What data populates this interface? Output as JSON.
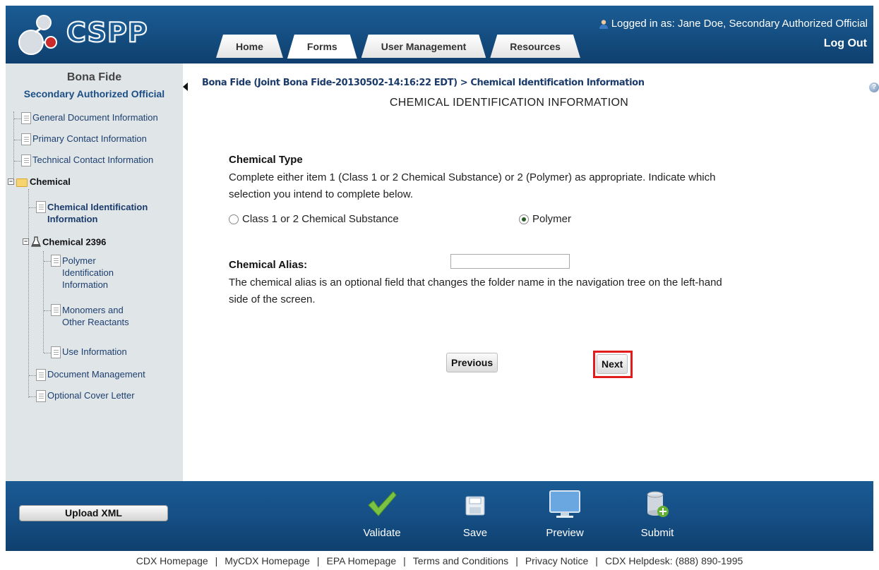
{
  "header": {
    "app_name": "CSPP",
    "logged_in_text": "Logged in as: Jane Doe, Secondary Authorized Official",
    "logout_label": "Log Out",
    "tabs": [
      {
        "label": "Home",
        "active": false
      },
      {
        "label": "Forms",
        "active": true
      },
      {
        "label": "User Management",
        "active": false
      },
      {
        "label": "Resources",
        "active": false
      }
    ]
  },
  "sidebar": {
    "title": "Bona Fide",
    "subtitle": "Secondary Authorized Official",
    "items": [
      {
        "label": "General Document Information"
      },
      {
        "label": "Primary Contact Information"
      },
      {
        "label": "Technical Contact Information"
      },
      {
        "label": "Chemical"
      },
      {
        "label_line1": "Chemical Identification",
        "label_line2": "Information"
      },
      {
        "label": "Chemical 2396"
      },
      {
        "label_line1": "Polymer",
        "label_line2": "Identification",
        "label_line3": "Information"
      },
      {
        "label_line1": "Monomers and",
        "label_line2": "Other Reactants"
      },
      {
        "label": "Use Information"
      },
      {
        "label": "Document Management"
      },
      {
        "label": "Optional Cover Letter"
      }
    ]
  },
  "main": {
    "breadcrumb": "Bona Fide (Joint Bona Fide-20130502-14:16:22 EDT) > Chemical Identification Information",
    "page_title": "CHEMICAL IDENTIFICATION INFORMATION",
    "chemical_type": {
      "heading": "Chemical Type",
      "instructions_line1": "Complete either item 1 (Class 1 or 2 Chemical Substance) or 2 (Polymer) as appropriate. Indicate which",
      "instructions_line2": "selection you intend to complete below.",
      "options": [
        {
          "label": "Class 1 or 2 Chemical Substance",
          "selected": false
        },
        {
          "label": "Polymer",
          "selected": true
        }
      ]
    },
    "chemical_alias": {
      "label": "Chemical Alias:",
      "value": "",
      "description_line1": "The chemical alias is an optional field that changes the folder name in the navigation tree on the left-hand",
      "description_line2": "side of the screen."
    },
    "buttons": {
      "previous": "Previous",
      "next": "Next"
    },
    "help_icon": "help-icon"
  },
  "action_bar": {
    "upload_label": "Upload XML",
    "actions": [
      {
        "label": "Validate",
        "icon": "checkmark-icon"
      },
      {
        "label": "Save",
        "icon": "floppy-disk-icon"
      },
      {
        "label": "Preview",
        "icon": "monitor-icon"
      },
      {
        "label": "Submit",
        "icon": "database-add-icon"
      }
    ]
  },
  "footer": {
    "links": [
      "CDX Homepage",
      "MyCDX Homepage",
      "EPA Homepage",
      "Terms and Conditions",
      "Privacy Notice",
      "CDX Helpdesk: (888) 890-1995"
    ],
    "separator": "|"
  },
  "colors": {
    "header_blue": "#1b5c94",
    "sidebar_bg": "#e0e5e8",
    "highlight_red": "#e21b1b",
    "link_blue": "#1b3b6b"
  }
}
